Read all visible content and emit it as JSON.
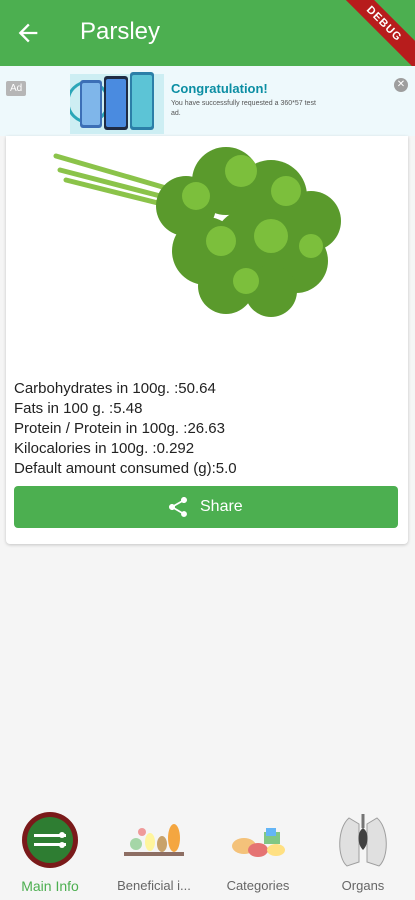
{
  "appbar": {
    "title": "Parsley",
    "debug_label": "DEBUG",
    "back_icon": "arrow-back-icon",
    "color": "#4caf50"
  },
  "ad": {
    "tag": "Ad",
    "title": "Congratulation!",
    "text": "You have successfully requested a 360*57 test ad.",
    "close_icon": "close-icon"
  },
  "food": {
    "image_icon": "parsley-image",
    "facts": [
      "Carbohydrates in 100g. :50.64",
      "Fats in 100 g. :5.48",
      "Protein / Protein in 100g. :26.63",
      "Kilocalories in 100g. :0.292",
      "Default amount consumed (g):5.0"
    ],
    "share_label": "Share",
    "share_icon": "share-icon"
  },
  "nav": {
    "items": [
      {
        "label": "Main Info",
        "icon": "main-info-icon",
        "active": true
      },
      {
        "label": "Beneficial i...",
        "icon": "beneficial-icon",
        "active": false
      },
      {
        "label": "Categories",
        "icon": "categories-icon",
        "active": false
      },
      {
        "label": "Organs",
        "icon": "organs-icon",
        "active": false
      }
    ]
  }
}
